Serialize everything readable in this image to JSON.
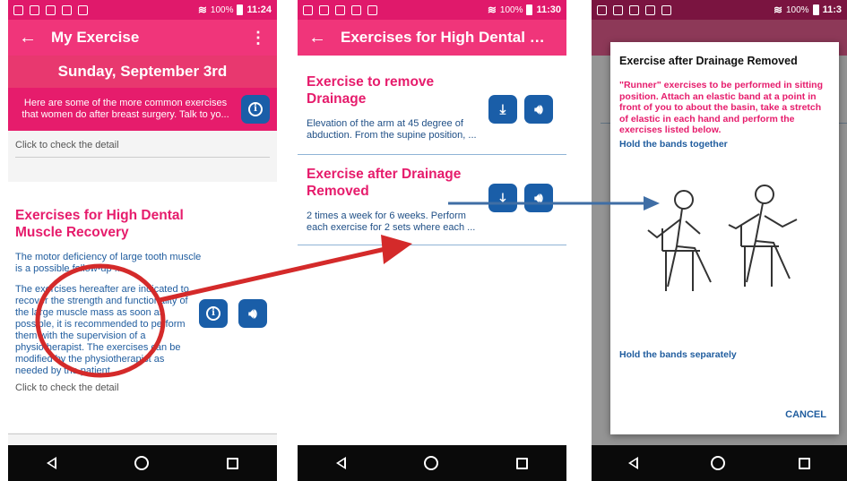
{
  "status": {
    "battery": "100%",
    "time1": "11:24",
    "time2": "11:30",
    "time3": "11:3"
  },
  "screen1": {
    "title": "My Exercise",
    "date": "Sunday, September 3rd",
    "info": "Here are some of the more common exercises that women do after breast surgery. Talk to yo...",
    "click_detail_1": "Click to check the detail",
    "card_title": "Exercises for High Dental Muscle Recovery",
    "card_desc": "The motor deficiency of large tooth muscle is a possible follow-up ...",
    "card_body": "The exercises hereafter are indicated to recover the strength and functionality of the large muscle mass as soon as possible, it is recommended to perform them with the supervision of a physiotherapist. The exercises can be modified by the physiotherapist as needed by the patient.",
    "click_detail_2": "Click to check the detail"
  },
  "screen2": {
    "title": "Exercises for High Dental Mu...",
    "items": [
      {
        "title": "Exercise to remove Drainage",
        "desc": "Elevation of the arm at 45 degree of abduction. From the supine position, ..."
      },
      {
        "title": "Exercise after Drainage Removed",
        "desc": "2 times a week for 6 weeks. Perform each exercise for 2 sets where each ..."
      }
    ]
  },
  "screen3": {
    "dialog_title": "Exercise after Drainage Removed",
    "dialog_desc": "\"Runner\" exercises to be performed in sitting position. Attach an elastic band at a point in front of you to about the basin, take a stretch of elastic in each hand and perform the exercises listed below.",
    "label_together": "Hold the bands together",
    "label_separately": "Hold the bands separately",
    "cancel": "CANCEL"
  },
  "colors": {
    "pink": "#e61c6c",
    "blue": "#1f5c9e",
    "arrow_red": "#d42a2a",
    "arrow_blue": "#3f6ea5"
  }
}
